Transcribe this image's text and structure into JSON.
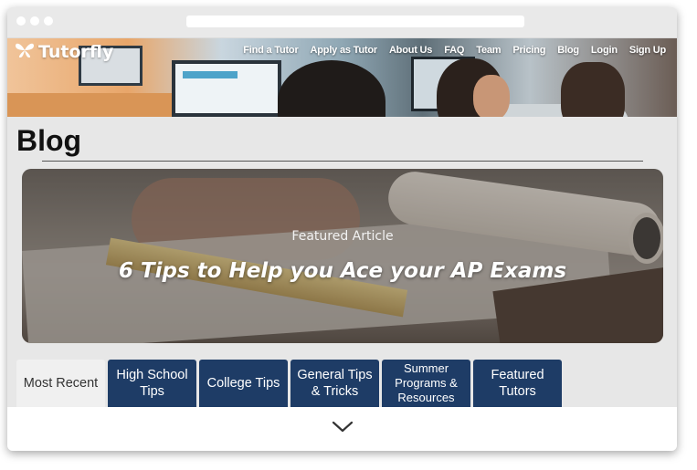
{
  "nav": {
    "logo_text": "Tutorfly",
    "links": [
      "Find a Tutor",
      "Apply as Tutor",
      "About Us",
      "FAQ",
      "Team",
      "Pricing",
      "Blog",
      "Login",
      "Sign Up"
    ]
  },
  "page": {
    "title": "Blog"
  },
  "featured": {
    "label": "Featured Article",
    "title": "6 Tips to Help you Ace your AP Exams"
  },
  "tabs": [
    {
      "label": "Most Recent",
      "active": true
    },
    {
      "label": "High School Tips",
      "active": false
    },
    {
      "label": "College Tips",
      "active": false
    },
    {
      "label": "General Tips & Tricks",
      "active": false
    },
    {
      "label": "Summer Programs & Resources",
      "active": false
    },
    {
      "label": "Featured Tutors",
      "active": false
    }
  ],
  "colors": {
    "tab_bg": "#1e3c66",
    "tab_active_bg": "#f0f0f0",
    "page_bg": "#e7e7e7"
  },
  "icons": {
    "logo": "butterfly-icon",
    "scroll": "chevron-down-icon"
  }
}
